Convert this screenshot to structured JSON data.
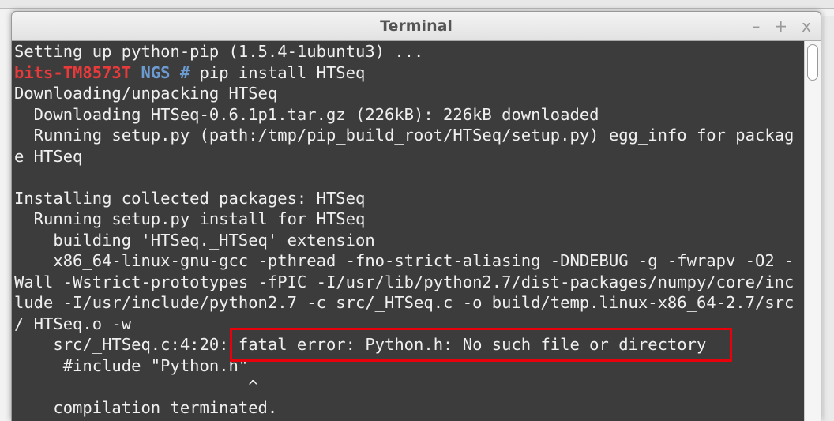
{
  "window": {
    "title": "Terminal",
    "controls": {
      "minimize": "–",
      "maximize": "+",
      "close": "x"
    }
  },
  "prompt": {
    "host": "bits-TM8573T",
    "dir": "NGS",
    "symbol": "#",
    "command": "pip install HTSeq"
  },
  "lines": [
    "Setting up python-pip (1.5.4-1ubuntu3) ...",
    null,
    "Downloading/unpacking HTSeq",
    "  Downloading HTSeq-0.6.1p1.tar.gz (226kB): 226kB downloaded",
    "  Running setup.py (path:/tmp/pip_build_root/HTSeq/setup.py) egg_info for packag",
    "e HTSeq",
    "",
    "Installing collected packages: HTSeq",
    "  Running setup.py install for HTSeq",
    "    building 'HTSeq._HTSeq' extension",
    "    x86_64-linux-gnu-gcc -pthread -fno-strict-aliasing -DNDEBUG -g -fwrapv -O2 -",
    "Wall -Wstrict-prototypes -fPIC -I/usr/lib/python2.7/dist-packages/numpy/core/inc",
    "lude -I/usr/include/python2.7 -c src/_HTSeq.c -o build/temp.linux-x86_64-2.7/src",
    "/_HTSeq.o -w",
    "    src/_HTSeq.c:4:20: fatal error: Python.h: No such file or directory",
    "     #include \"Python.h\"",
    "                        ^",
    "    compilation terminated."
  ],
  "highlight_color": "#e8000b"
}
